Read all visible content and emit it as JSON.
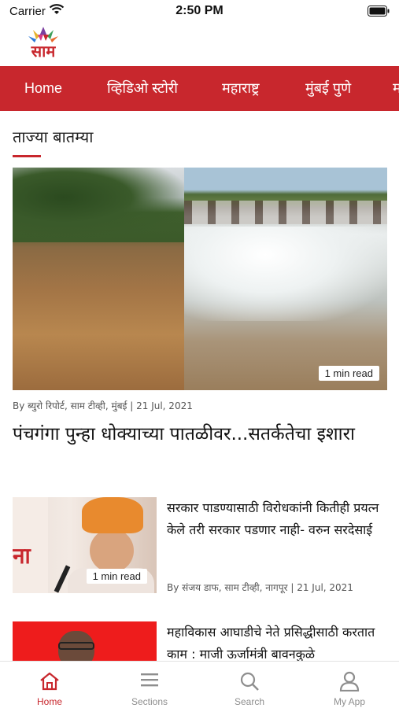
{
  "status_bar": {
    "carrier": "Carrier",
    "time": "2:50 PM"
  },
  "logo": {
    "text": "साम"
  },
  "nav": {
    "items": [
      {
        "label": "Home",
        "active": true
      },
      {
        "label": "व्हिडिओ स्टोरी"
      },
      {
        "label": "महाराष्ट्र"
      },
      {
        "label": "मुंबई पुणे"
      },
      {
        "label": "म"
      }
    ]
  },
  "section": {
    "title": "ताज्या बातम्या"
  },
  "hero": {
    "read_time": "1 min read",
    "meta": "By ब्युरो रिपोर्ट, साम टीव्ही, मुंबई | 21 Jul, 2021",
    "headline": "पंचगंगा पुन्हा धोक्याच्या पातळीवर...सतर्कतेचा इशारा"
  },
  "articles": [
    {
      "title": "सरकार पाडण्यासाठी विरोधकांनी कितीही प्रयत्न केले तरी सरकार पडणार नाही- वरुन सरदेसाई",
      "read_time": "1 min read",
      "meta": "By संजय डाफ, साम टीव्ही, नागपूर | 21 Jul, 2021",
      "thumb_text": "ना"
    },
    {
      "title": "महाविकास आघाडीचे नेते प्रसिद्धीसाठी करतात काम : माजी ऊर्जामंत्री बावनकुळे"
    }
  ],
  "tabbar": {
    "tabs": [
      {
        "label": "Home",
        "icon": "home-icon",
        "active": true
      },
      {
        "label": "Sections",
        "icon": "menu-icon"
      },
      {
        "label": "Search",
        "icon": "search-icon"
      },
      {
        "label": "My App",
        "icon": "user-icon"
      }
    ]
  },
  "colors": {
    "brand": "#c8272d",
    "tab_inactive": "#8e8e8e"
  }
}
